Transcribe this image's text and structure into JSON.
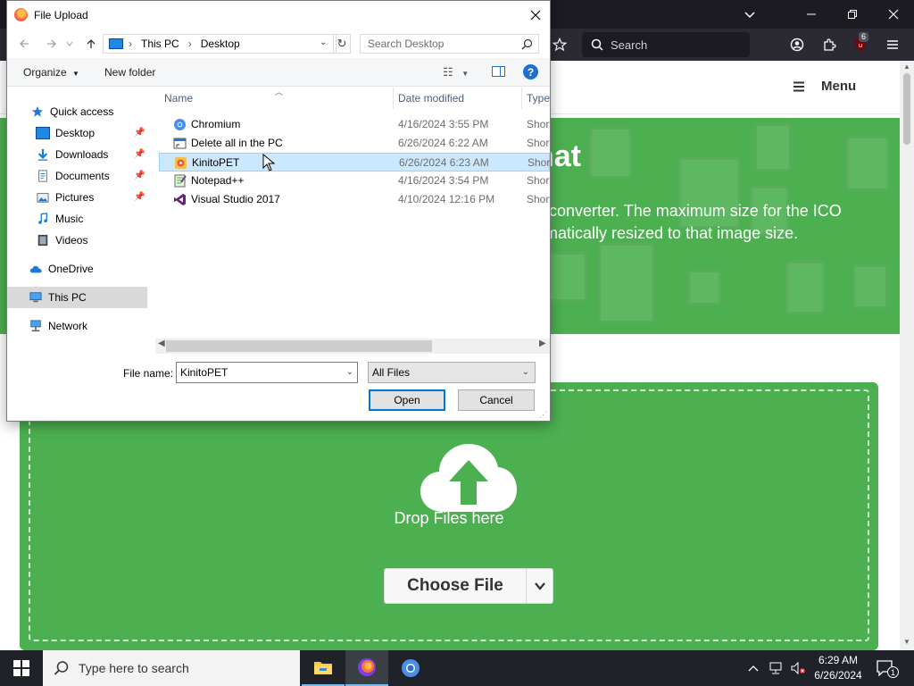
{
  "browser": {
    "search_placeholder": "Search",
    "extension_badge": "6",
    "page_menu_label": "Menu",
    "hero_title": "nat",
    "hero_text_line1": "o converter. The maximum size for the ICO",
    "hero_text_line2": "omatically resized to that image size.",
    "drop_label": "Drop Files here",
    "choose_file_label": "Choose File"
  },
  "dialog": {
    "title": "File Upload",
    "address": {
      "segments": [
        "This PC",
        "Desktop"
      ]
    },
    "search_placeholder": "Search Desktop",
    "commands": {
      "organize": "Organize",
      "new_folder": "New folder"
    },
    "nav": [
      {
        "label": "Quick access",
        "icon": "star-icon"
      },
      {
        "label": "Desktop",
        "icon": "desktop-folder-icon",
        "pinned": true
      },
      {
        "label": "Downloads",
        "icon": "download-folder-icon",
        "pinned": true
      },
      {
        "label": "Documents",
        "icon": "documents-folder-icon",
        "pinned": true
      },
      {
        "label": "Pictures",
        "icon": "pictures-folder-icon",
        "pinned": true
      },
      {
        "label": "Music",
        "icon": "music-folder-icon"
      },
      {
        "label": "Videos",
        "icon": "videos-folder-icon"
      },
      {
        "label": "OneDrive",
        "icon": "onedrive-cloud-icon"
      },
      {
        "label": "This PC",
        "icon": "computer-icon",
        "selected": true
      },
      {
        "label": "Network",
        "icon": "network-icon"
      }
    ],
    "columns": {
      "name": "Name",
      "date": "Date modified",
      "type": "Type"
    },
    "files": [
      {
        "name": "Chromium",
        "date": "4/16/2024 3:55 PM",
        "type": "Shortcut",
        "icon": "chromium-shortcut-icon"
      },
      {
        "name": "Delete all in the PC",
        "date": "6/26/2024 6:22 AM",
        "type": "Shortcut",
        "icon": "app-shortcut-icon"
      },
      {
        "name": "KinitoPET",
        "date": "6/26/2024 6:23 AM",
        "type": "Shortcut",
        "icon": "kinitopet-shortcut-icon",
        "selected": true
      },
      {
        "name": "Notepad++",
        "date": "4/16/2024 3:54 PM",
        "type": "Shortcut",
        "icon": "notepadpp-shortcut-icon"
      },
      {
        "name": "Visual Studio 2017",
        "date": "4/10/2024 12:16 PM",
        "type": "Shortcut",
        "icon": "visual-studio-shortcut-icon"
      }
    ],
    "file_name_label": "File name:",
    "file_name_value": "KinitoPET",
    "file_type_value": "All Files",
    "open_label": "Open",
    "cancel_label": "Cancel"
  },
  "taskbar": {
    "search_placeholder": "Type here to search",
    "time": "6:29 AM",
    "date": "6/26/2024",
    "notification_count": "1"
  }
}
